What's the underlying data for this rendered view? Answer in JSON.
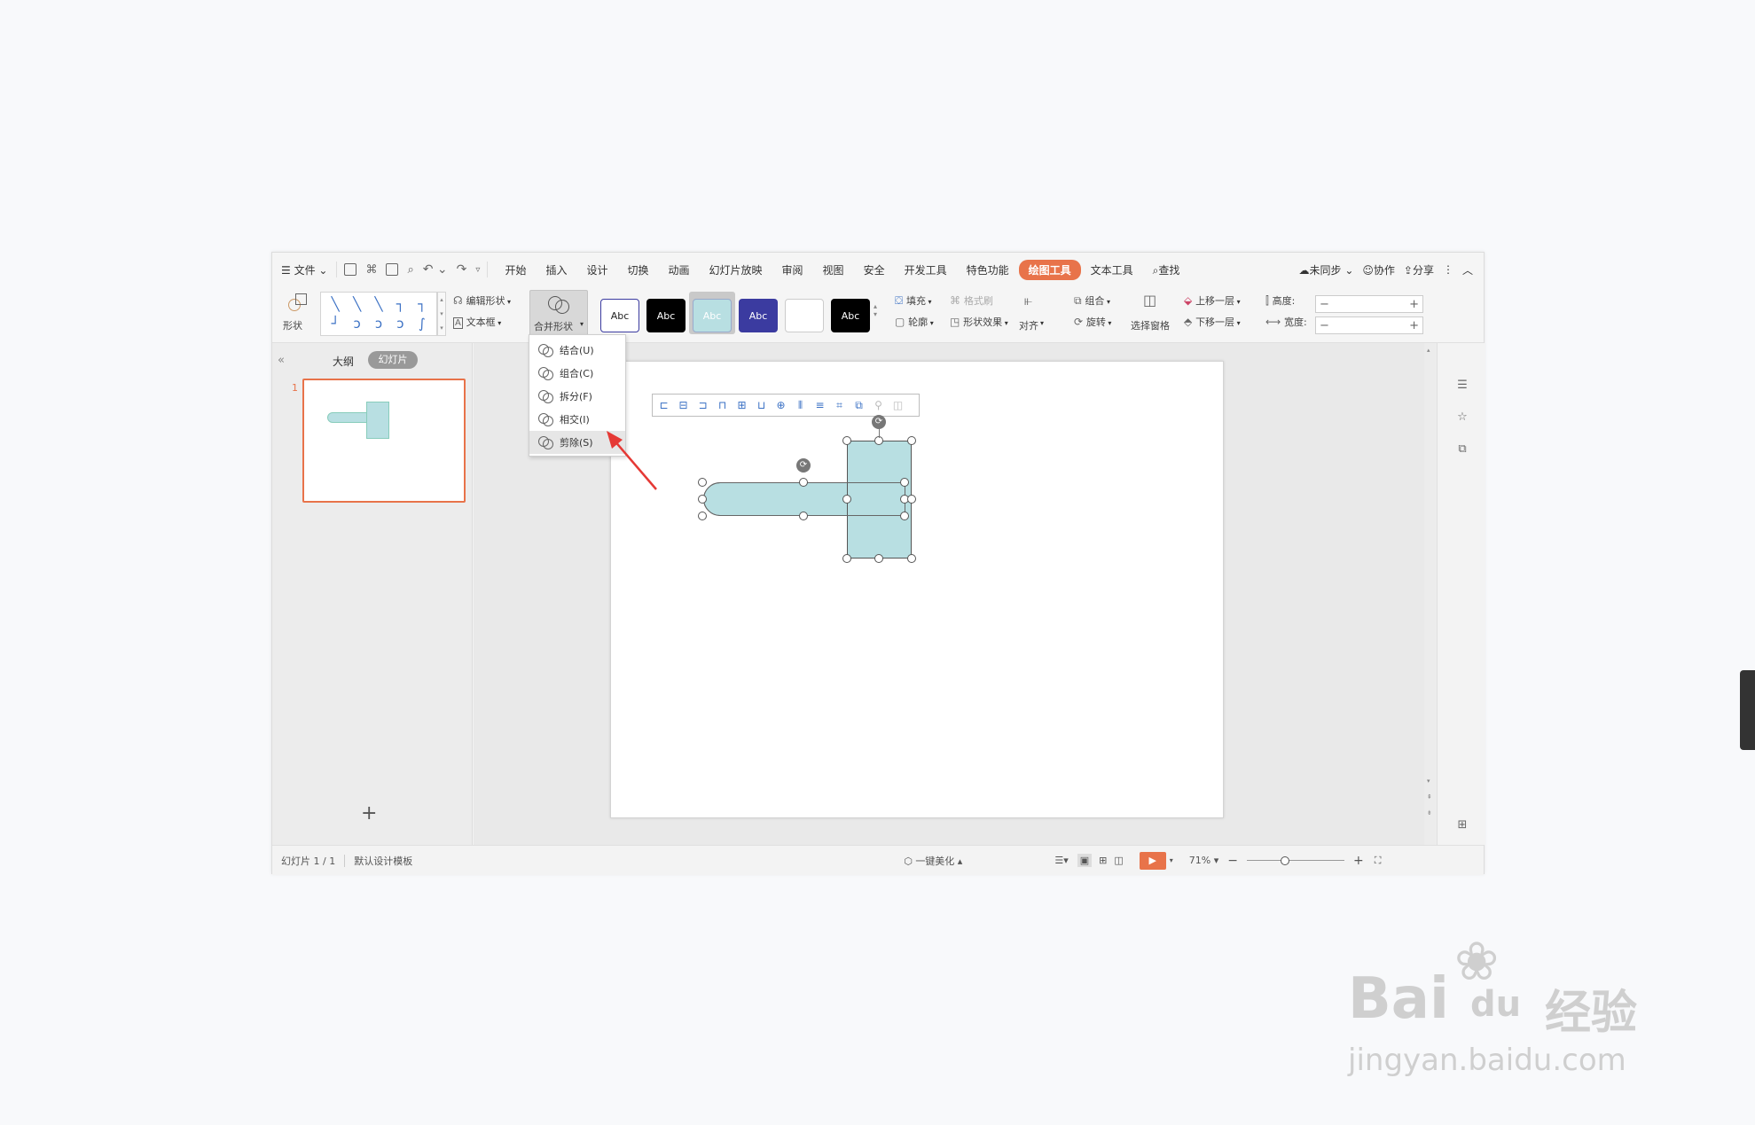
{
  "menubar": {
    "file": "文件",
    "tabs": [
      "开始",
      "插入",
      "设计",
      "切换",
      "动画",
      "幻灯片放映",
      "审阅",
      "视图",
      "安全",
      "开发工具",
      "特色功能",
      "绘图工具",
      "文本工具"
    ],
    "active_tab": "绘图工具",
    "search": "查找",
    "sync": "未同步",
    "collab": "协作",
    "share": "分享"
  },
  "ribbon": {
    "shape": "形状",
    "edit_shape": "编辑形状",
    "text_box": "文本框",
    "merge_shape": "合并形状",
    "style_label": "Abc",
    "fill": "填充",
    "format_painter": "格式刷",
    "outline": "轮廓",
    "shape_effect": "形状效果",
    "align": "对齐",
    "group": "组合",
    "rotate": "旋转",
    "select_pane": "选择窗格",
    "bring_forward": "上移一层",
    "send_backward": "下移一层",
    "height_label": "高度:",
    "width_label": "宽度:",
    "minus": "−",
    "plus": "+"
  },
  "merge_menu": {
    "items": [
      "结合(U)",
      "组合(C)",
      "拆分(F)",
      "相交(I)",
      "剪除(S)"
    ],
    "highlighted": "剪除(S)"
  },
  "left_panel": {
    "tab_outline": "大纲",
    "tab_slides": "幻灯片",
    "slide_number": "1",
    "add": "+"
  },
  "status": {
    "slide_info": "幻灯片 1 / 1",
    "template": "默认设计模板",
    "beautify": "一键美化",
    "zoom": "71%"
  },
  "colors": {
    "accent": "#e8734a",
    "shape_fill": "#b8dfe2",
    "swatch_navy": "#3b3ba0",
    "swatch_black": "#000000",
    "icon_blue": "#3a70c4"
  },
  "watermark": {
    "brand": "Bai",
    "brand2": "du",
    "cn": "经验",
    "url": "jingyan.baidu.com"
  }
}
